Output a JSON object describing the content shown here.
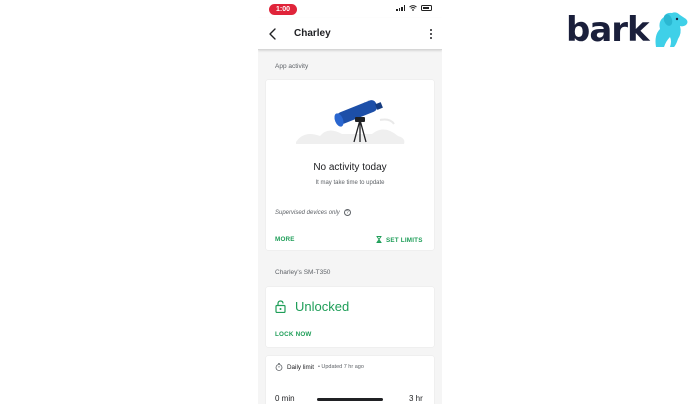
{
  "status_bar": {
    "time": "1:00"
  },
  "header": {
    "title": "Charley"
  },
  "app_activity": {
    "section_label": "App activity",
    "empty_title": "No activity today",
    "empty_subtitle": "It may take time to update",
    "supervised_note": "Supervised devices only",
    "help_glyph": "?",
    "more_label": "MORE",
    "set_limits_label": "SET LIMITS"
  },
  "device": {
    "section_label": "Charley's SM-T350",
    "lock_status": "Unlocked",
    "lock_now_label": "LOCK NOW"
  },
  "daily_limit": {
    "label": "Daily limit",
    "updated": "• Updated 7 hr ago",
    "min_label": "0 min",
    "max_label": "3 hr"
  },
  "logo": {
    "text": "bark"
  },
  "colors": {
    "accent_green": "#1e9e58",
    "status_red": "#e0243a",
    "brand_navy": "#1a1f3b",
    "brand_cyan": "#3fd0e8",
    "telescope_blue": "#1d4fa8"
  },
  "icons": [
    "back-arrow-icon",
    "more-vert-icon",
    "telescope-icon",
    "help-icon",
    "hourglass-icon",
    "lock-open-icon",
    "timer-icon",
    "dog-icon"
  ]
}
